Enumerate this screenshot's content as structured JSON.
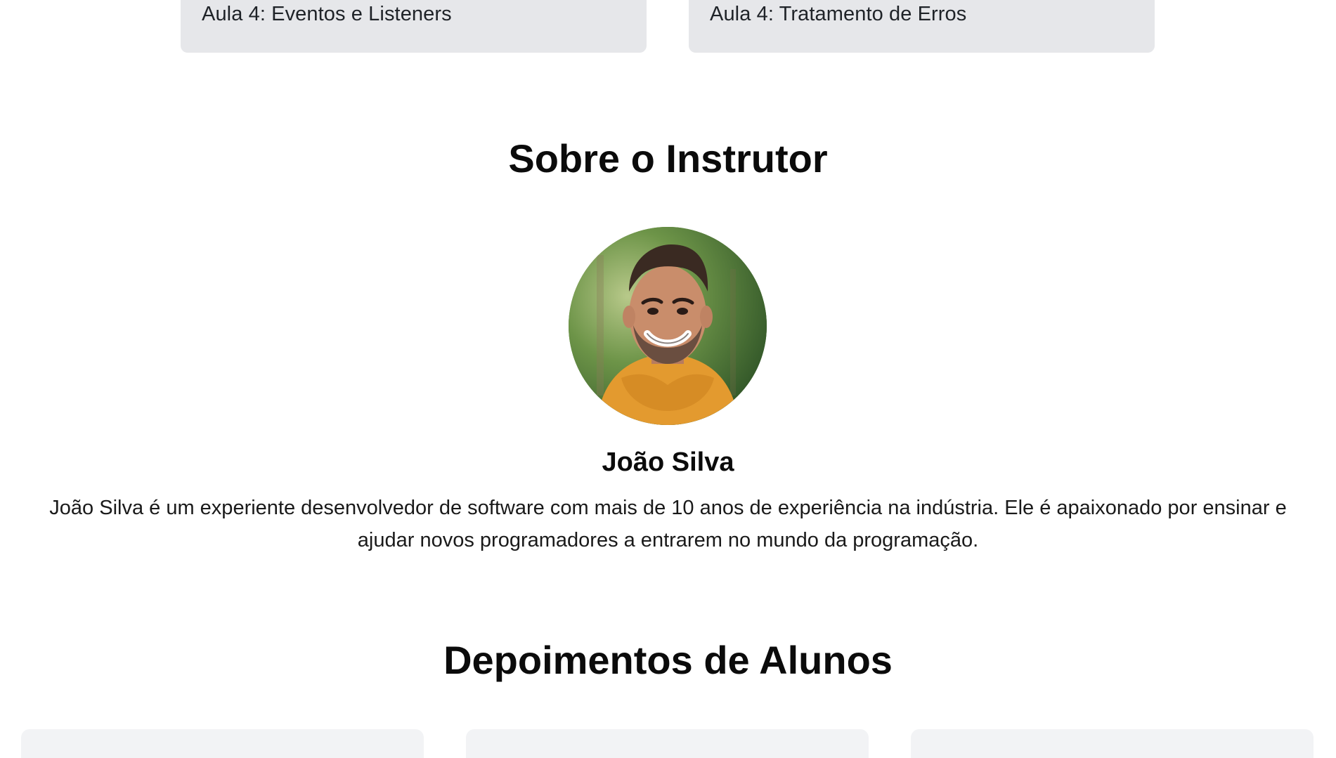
{
  "lessons": [
    {
      "label": "Aula 4: Eventos e Listeners"
    },
    {
      "label": "Aula 4: Tratamento de Erros"
    }
  ],
  "instructor": {
    "section_title": "Sobre o Instrutor",
    "name": "João Silva",
    "bio": "João Silva é um experiente desenvolvedor de software com mais de 10 anos de experiência na indústria. Ele é apaixonado por ensinar e ajudar novos programadores a entrarem no mundo da programação.",
    "avatar_colors": {
      "hoodie": "#e39a2f",
      "skin": "#c98d6b",
      "hair": "#3a2a22",
      "beard": "#4a3a32"
    }
  },
  "testimonials": {
    "section_title": "Depoimentos de Alunos",
    "card_count_visible": 3
  }
}
